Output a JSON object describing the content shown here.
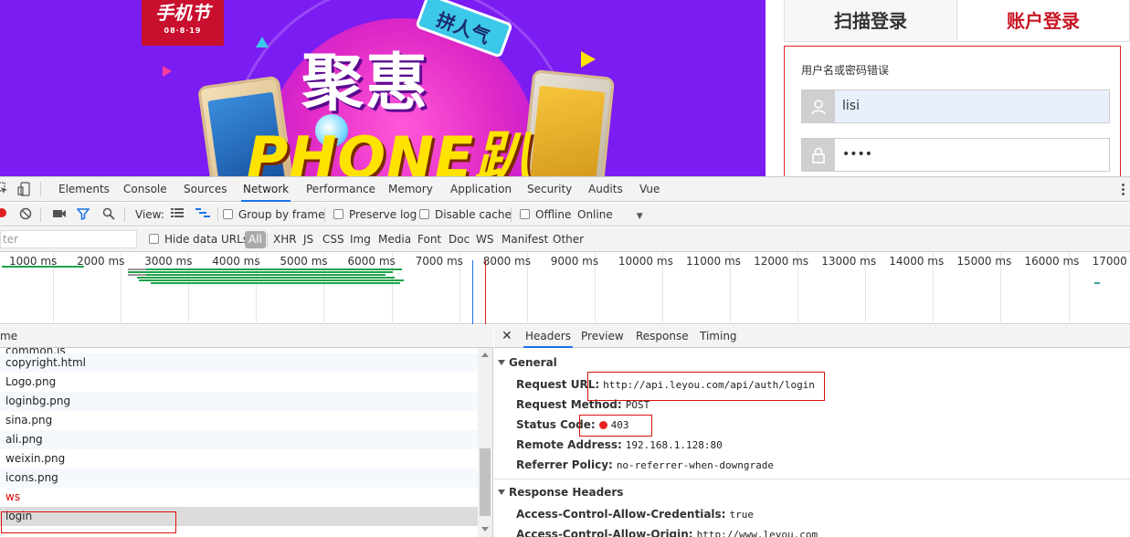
{
  "banner": {
    "logo_line1": "手机节",
    "logo_line2": "08·8·19",
    "tag": "拼人气",
    "headline1": "聚惠",
    "headline2": "PHONE趴"
  },
  "login": {
    "tab_scan": "扫描登录",
    "tab_account": "账户登录",
    "error_message": "用户名或密码错误",
    "username_value": "lisi",
    "password_value": "••••"
  },
  "devtools": {
    "tabs": [
      "Elements",
      "Console",
      "Sources",
      "Network",
      "Performance",
      "Memory",
      "Application",
      "Security",
      "Audits",
      "Vue"
    ],
    "active_tab": "Network",
    "toolbar": {
      "view_label": "View:",
      "group_by_frame": "Group by frame",
      "preserve_log": "Preserve log",
      "disable_cache": "Disable cache",
      "offline": "Offline",
      "throttle": "Online"
    },
    "filter": {
      "placeholder": "ter",
      "hide_data_urls": "Hide data URLs",
      "types": [
        "All",
        "XHR",
        "JS",
        "CSS",
        "Img",
        "Media",
        "Font",
        "Doc",
        "WS",
        "Manifest",
        "Other"
      ]
    },
    "timeline_labels": [
      "1000 ms",
      "2000 ms",
      "3000 ms",
      "4000 ms",
      "5000 ms",
      "6000 ms",
      "7000 ms",
      "8000 ms",
      "9000 ms",
      "10000 ms",
      "11000 ms",
      "12000 ms",
      "13000 ms",
      "14000 ms",
      "15000 ms",
      "16000 ms",
      "17000 ms"
    ],
    "requests": {
      "column_header": "me",
      "items": [
        "common.js",
        "copyright.html",
        "Logo.png",
        "loginbg.png",
        "sina.png",
        "ali.png",
        "weixin.png",
        "icons.png",
        "ws",
        "login"
      ]
    },
    "details": {
      "tabs": [
        "Headers",
        "Preview",
        "Response",
        "Timing"
      ],
      "active_tab": "Headers",
      "general_title": "General",
      "request_url_key": "Request URL:",
      "request_url": "http://api.leyou.com/api/auth/login",
      "request_method_key": "Request Method:",
      "request_method": "POST",
      "status_code_key": "Status Code:",
      "status_code": "403",
      "remote_address_key": "Remote Address:",
      "remote_address": "192.168.1.128:80",
      "referrer_policy_key": "Referrer Policy:",
      "referrer_policy": "no-referrer-when-downgrade",
      "response_headers_title": "Response Headers",
      "acac_key": "Access-Control-Allow-Credentials:",
      "acac_value": "true",
      "acao_key": "Access-Control-Allow-Origin:",
      "acao_value": "http://www.leyou.com"
    }
  },
  "colors": {
    "banner_bg": "#7b1cf2",
    "accent_red": "#c81623",
    "devtools_blue": "#1a73e8"
  }
}
